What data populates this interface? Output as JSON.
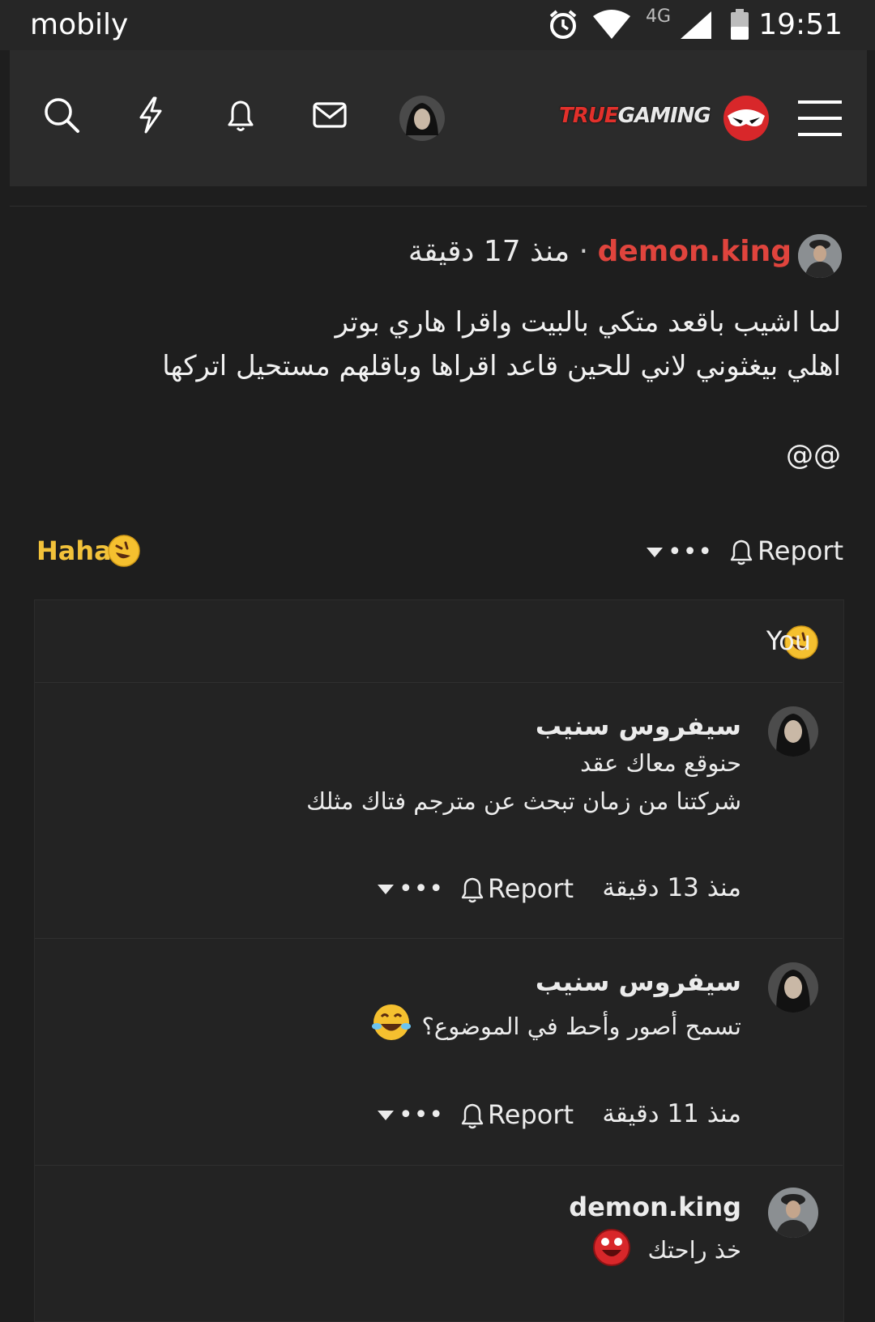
{
  "status_bar": {
    "carrier": "mobily",
    "network": "4G",
    "time": "19:51"
  },
  "header": {
    "logo_part1": "TRUE",
    "logo_part2": "GAMING",
    "icons": [
      "search-icon",
      "lightning-icon",
      "bell-icon",
      "mail-icon",
      "avatar",
      "logo",
      "menu-icon"
    ]
  },
  "post": {
    "author": "demon.king",
    "separator": "·",
    "time": "منذ 17 دقيقة",
    "lines": [
      "لما اشيب باقعد متكي بالبيت واقرا هاري بوتر",
      "اهلي بيغثوني لاني للحين قاعد اقراها وباقلهم مستحيل اتركها",
      "@@"
    ],
    "reaction_label": "Haha",
    "report_label": "Report",
    "more_label": "•••"
  },
  "reactions": {
    "you_label": "You"
  },
  "comments": [
    {
      "author": "سيفروس سنيب",
      "lines": [
        "حنوقع معاك عقد",
        "شركتنا من زمان تبحث عن مترجم فتاك مثلك"
      ],
      "time": "منذ 13 دقيقة",
      "report_label": "Report",
      "more_label": "•••"
    },
    {
      "author": "سيفروس سنيب",
      "lines": [
        "تسمح أصور وأحط في الموضوع؟"
      ],
      "time": "منذ 11 دقيقة",
      "report_label": "Report",
      "more_label": "•••"
    },
    {
      "author": "demon.king",
      "lines": [
        "خذ راحتك"
      ]
    }
  ],
  "colors": {
    "background": "#1e1e1e",
    "header": "#2b2b2b",
    "username_red": "#e0443d",
    "haha_yellow": "#f2c23a"
  }
}
